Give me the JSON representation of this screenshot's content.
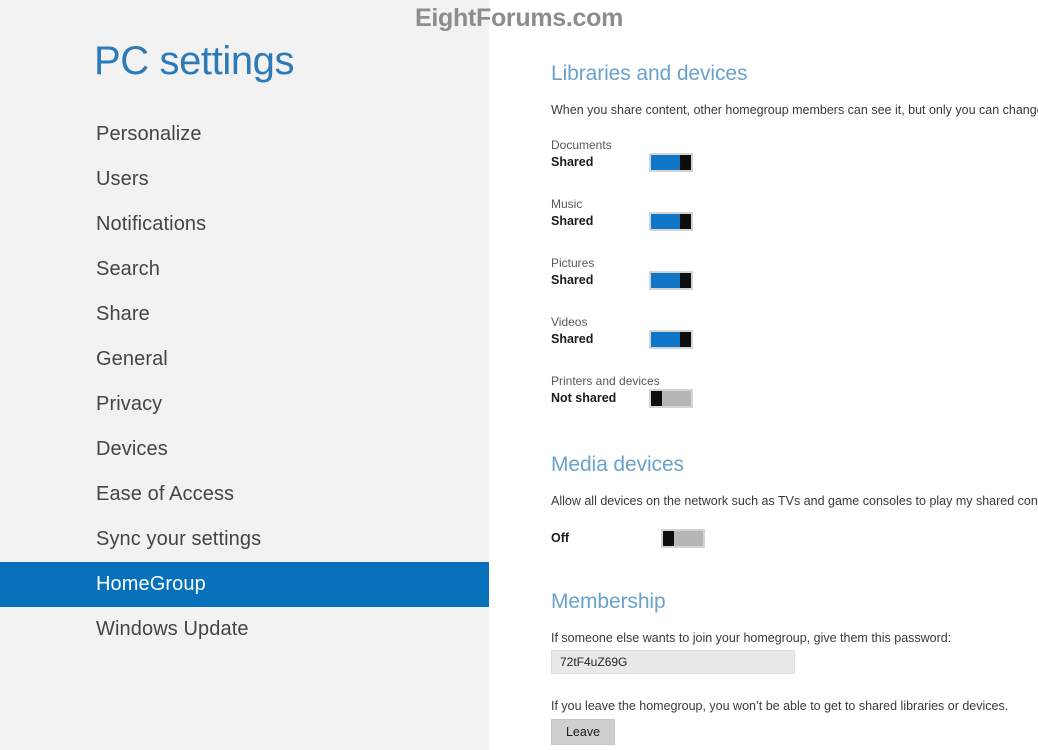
{
  "watermark": {
    "text": "EightForums.com"
  },
  "sidebar": {
    "title": "PC settings",
    "items": [
      {
        "label": "Personalize",
        "selected": false
      },
      {
        "label": "Users",
        "selected": false
      },
      {
        "label": "Notifications",
        "selected": false
      },
      {
        "label": "Search",
        "selected": false
      },
      {
        "label": "Share",
        "selected": false
      },
      {
        "label": "General",
        "selected": false
      },
      {
        "label": "Privacy",
        "selected": false
      },
      {
        "label": "Devices",
        "selected": false
      },
      {
        "label": "Ease of Access",
        "selected": false
      },
      {
        "label": "Sync your settings",
        "selected": false
      },
      {
        "label": "HomeGroup",
        "selected": true
      },
      {
        "label": "Windows Update",
        "selected": false
      }
    ],
    "accent_color": "#0670ba",
    "title_color": "#2c7ab8",
    "background_color": "#f2f2f2"
  },
  "content": {
    "libraries": {
      "heading": "Libraries and devices",
      "description": "When you share content, other homegroup members can see it, but only you can change it.",
      "toggles": [
        {
          "caption": "Documents",
          "state": "Shared",
          "on": true
        },
        {
          "caption": "Music",
          "state": "Shared",
          "on": true
        },
        {
          "caption": "Pictures",
          "state": "Shared",
          "on": true
        },
        {
          "caption": "Videos",
          "state": "Shared",
          "on": true
        },
        {
          "caption": "Printers and devices",
          "state": "Not shared",
          "on": false
        }
      ]
    },
    "media_devices": {
      "heading": "Media devices",
      "description": "Allow all devices on the network such as TVs and game consoles to play my shared content",
      "toggle": {
        "state": "Off",
        "on": false
      }
    },
    "membership": {
      "heading": "Membership",
      "password_prompt": "If someone else wants to join your homegroup, give them this password:",
      "password_value": "72tF4uZ69G",
      "leave_prompt": "If you leave the homegroup, you won’t be able to get to shared libraries or devices.",
      "leave_label": "Leave"
    },
    "heading_color": "#69a2cd",
    "switch_on_color": "#0f76c8",
    "switch_off_color": "#b6b6b6"
  }
}
